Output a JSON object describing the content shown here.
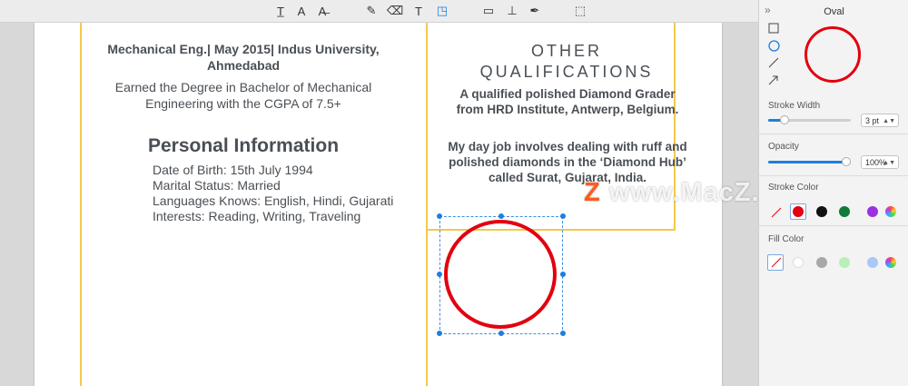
{
  "toolbar": {
    "tools": [
      {
        "name": "text-box-icon",
        "glyph": "T̲"
      },
      {
        "name": "text-edit-icon",
        "glyph": "A"
      },
      {
        "name": "strikethrough-icon",
        "glyph": "A̶"
      },
      {
        "name": "pencil-icon",
        "glyph": "✎"
      },
      {
        "name": "eraser-icon",
        "glyph": "⌫"
      },
      {
        "name": "text-tool-icon",
        "glyph": "T"
      },
      {
        "name": "shapes-icon",
        "glyph": "◳"
      },
      {
        "name": "comment-icon",
        "glyph": "▭"
      },
      {
        "name": "stamp-icon",
        "glyph": "⊥"
      },
      {
        "name": "pen-nib-icon",
        "glyph": "✒"
      },
      {
        "name": "crop-selection-icon",
        "glyph": "⬚"
      }
    ]
  },
  "document": {
    "education": {
      "title": "Mechanical Eng.| May 2015| Indus University, Ahmedabad",
      "description": "Earned the Degree in Bachelor of Mechanical Engineering with the CGPA of 7.5+"
    },
    "personal_info": {
      "heading": "Personal Information",
      "lines": [
        "Date of Birth: 15th July 1994",
        "Marital Status: Married",
        "Languages Knows: English, Hindi, Gujarati",
        "Interests: Reading, Writing, Traveling"
      ]
    },
    "other_qualifications": {
      "heading_line1": "OTHER",
      "heading_line2": "QUALIFICATIONS",
      "para1": "A qualified polished Diamond Grader from HRD Institute, Antwerp, Belgium.",
      "para2": "My day job involves dealing with ruff and polished diamonds in the ‘Diamond Hub’ called Surat, Gujarat, India."
    },
    "watermark": {
      "z": "Z",
      "text": " www.MacZ.com"
    }
  },
  "panel": {
    "title": "Oval",
    "collapse_glyph": "»",
    "stroke_width_label": "Stroke Width",
    "stroke_width_value": "3 pt",
    "stroke_width_fraction": 0.16,
    "opacity_label": "Opacity",
    "opacity_value": "100%",
    "opacity_fraction": 1.0,
    "stroke_color_label": "Stroke Color",
    "fill_color_label": "Fill Color",
    "stroke_colors": [
      "#e3000f",
      "#111111",
      "#0f7a3a",
      "#9b30e0"
    ],
    "fill_colors": [
      "#ffffff",
      "#a8a8a8",
      "#b8f0b8",
      "#a9c8f5"
    ],
    "selected_stroke": "#e3000f",
    "accent": "#1e7fe0"
  }
}
